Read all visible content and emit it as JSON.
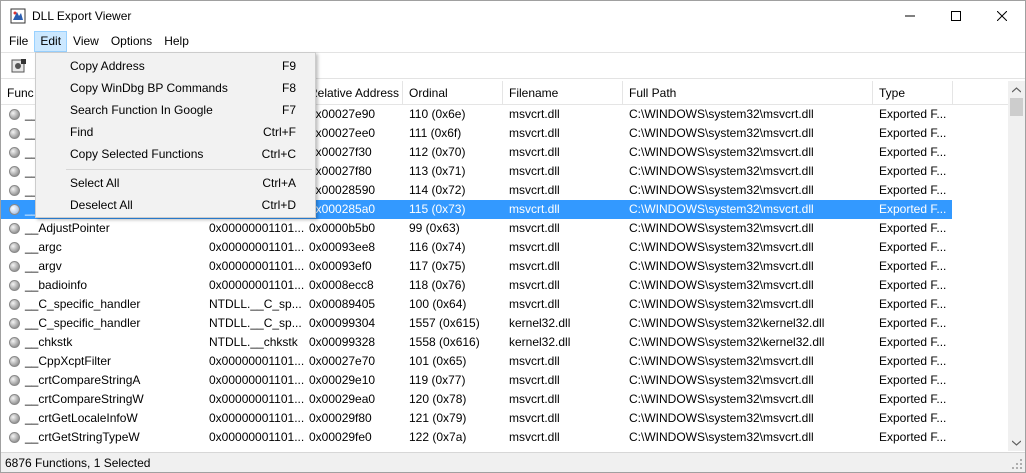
{
  "window": {
    "title": "DLL Export Viewer",
    "minimize_glyph": "—",
    "maximize_glyph": "☐",
    "close_glyph": "✕"
  },
  "menubar": {
    "items": [
      "File",
      "Edit",
      "View",
      "Options",
      "Help"
    ],
    "active": "Edit"
  },
  "edit_menu": {
    "items": [
      {
        "label": "Copy Address",
        "shortcut": "F9"
      },
      {
        "label": "Copy WinDbg BP Commands",
        "shortcut": "F8"
      },
      {
        "label": "Search Function In Google",
        "shortcut": "F7"
      },
      {
        "label": "Find",
        "shortcut": "Ctrl+F"
      },
      {
        "label": "Copy Selected Functions",
        "shortcut": "Ctrl+C"
      },
      {
        "label": "Select All",
        "shortcut": "Ctrl+A"
      },
      {
        "label": "Deselect All",
        "shortcut": "Ctrl+D"
      }
    ]
  },
  "table": {
    "columns": [
      "Func",
      "",
      "Relative Address",
      "Ordinal",
      "Filename",
      "Full Path",
      "Type"
    ],
    "rows": [
      [
        "__",
        "",
        "0x00027e90",
        "110 (0x6e)",
        "msvcrt.dll",
        "C:\\WINDOWS\\system32\\msvcrt.dll",
        "Exported F..."
      ],
      [
        "__",
        "",
        "0x00027ee0",
        "111 (0x6f)",
        "msvcrt.dll",
        "C:\\WINDOWS\\system32\\msvcrt.dll",
        "Exported F..."
      ],
      [
        "__",
        "",
        "0x00027f30",
        "112 (0x70)",
        "msvcrt.dll",
        "C:\\WINDOWS\\system32\\msvcrt.dll",
        "Exported F..."
      ],
      [
        "__",
        "",
        "0x00027f80",
        "113 (0x71)",
        "msvcrt.dll",
        "C:\\WINDOWS\\system32\\msvcrt.dll",
        "Exported F..."
      ],
      [
        "__",
        "",
        "0x00028590",
        "114 (0x72)",
        "msvcrt.dll",
        "C:\\WINDOWS\\system32\\msvcrt.dll",
        "Exported F..."
      ],
      [
        "__",
        "",
        "0x000285a0",
        "115 (0x73)",
        "msvcrt.dll",
        "C:\\WINDOWS\\system32\\msvcrt.dll",
        "Exported F..."
      ],
      [
        "__AdjustPointer",
        "0x00000001101...",
        "0x0000b5b0",
        "99 (0x63)",
        "msvcrt.dll",
        "C:\\WINDOWS\\system32\\msvcrt.dll",
        "Exported F..."
      ],
      [
        "__argc",
        "0x00000001101...",
        "0x00093ee8",
        "116 (0x74)",
        "msvcrt.dll",
        "C:\\WINDOWS\\system32\\msvcrt.dll",
        "Exported F..."
      ],
      [
        "__argv",
        "0x00000001101...",
        "0x00093ef0",
        "117 (0x75)",
        "msvcrt.dll",
        "C:\\WINDOWS\\system32\\msvcrt.dll",
        "Exported F..."
      ],
      [
        "__badioinfo",
        "0x00000001101...",
        "0x0008ecc8",
        "118 (0x76)",
        "msvcrt.dll",
        "C:\\WINDOWS\\system32\\msvcrt.dll",
        "Exported F..."
      ],
      [
        "__C_specific_handler",
        "NTDLL.__C_sp...",
        "0x00089405",
        "100 (0x64)",
        "msvcrt.dll",
        "C:\\WINDOWS\\system32\\msvcrt.dll",
        "Exported F..."
      ],
      [
        "__C_specific_handler",
        "NTDLL.__C_sp...",
        "0x00099304",
        "1557 (0x615)",
        "kernel32.dll",
        "C:\\WINDOWS\\system32\\kernel32.dll",
        "Exported F..."
      ],
      [
        "__chkstk",
        "NTDLL.__chkstk",
        "0x00099328",
        "1558 (0x616)",
        "kernel32.dll",
        "C:\\WINDOWS\\system32\\kernel32.dll",
        "Exported F..."
      ],
      [
        "__CppXcptFilter",
        "0x00000001101...",
        "0x00027e70",
        "101 (0x65)",
        "msvcrt.dll",
        "C:\\WINDOWS\\system32\\msvcrt.dll",
        "Exported F..."
      ],
      [
        "__crtCompareStringA",
        "0x00000001101...",
        "0x00029e10",
        "119 (0x77)",
        "msvcrt.dll",
        "C:\\WINDOWS\\system32\\msvcrt.dll",
        "Exported F..."
      ],
      [
        "__crtCompareStringW",
        "0x00000001101...",
        "0x00029ea0",
        "120 (0x78)",
        "msvcrt.dll",
        "C:\\WINDOWS\\system32\\msvcrt.dll",
        "Exported F..."
      ],
      [
        "__crtGetLocaleInfoW",
        "0x00000001101...",
        "0x00029f80",
        "121 (0x79)",
        "msvcrt.dll",
        "C:\\WINDOWS\\system32\\msvcrt.dll",
        "Exported F..."
      ],
      [
        "__crtGetStringTypeW",
        "0x00000001101...",
        "0x00029fe0",
        "122 (0x7a)",
        "msvcrt.dll",
        "C:\\WINDOWS\\system32\\msvcrt.dll",
        "Exported F..."
      ]
    ],
    "selected_row": 5
  },
  "status": {
    "text": "6876 Functions, 1 Selected"
  },
  "colors": {
    "selection": "#3399ff",
    "menu_highlight": "#cce8ff"
  }
}
